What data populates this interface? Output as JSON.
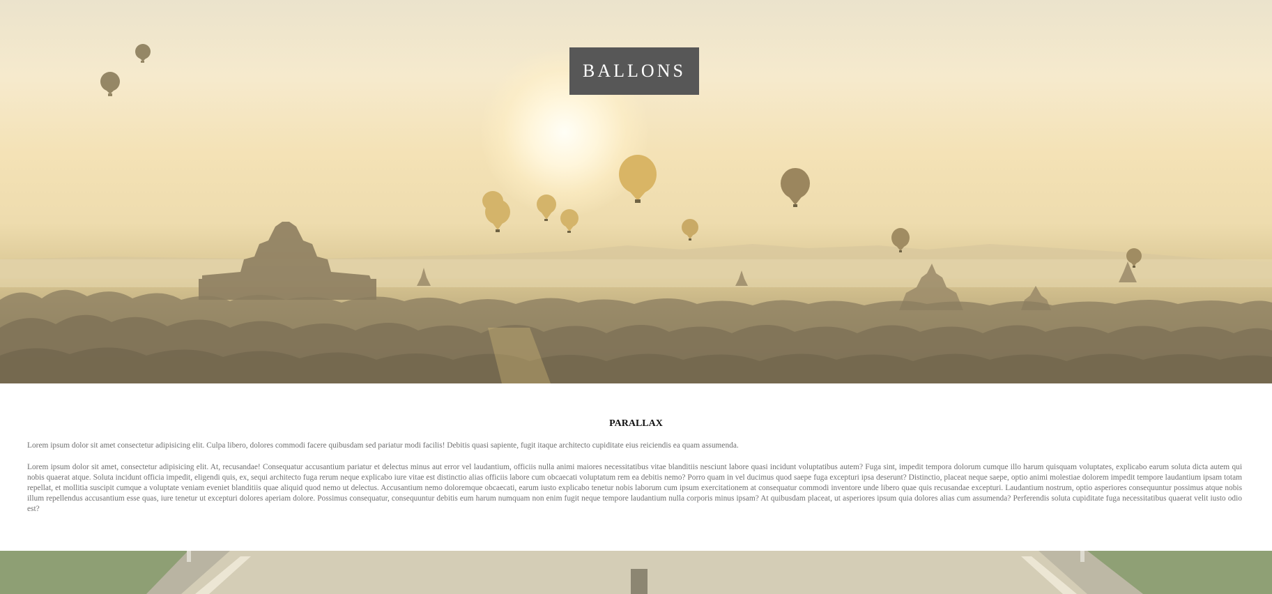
{
  "hero": {
    "title": "BALLONS"
  },
  "section": {
    "title": "PARALLAX",
    "paragraph1": "Lorem ipsum dolor sit amet consectetur adipisicing elit. Culpa libero, dolores commodi facere quibusdam sed pariatur modi facilis! Debitis quasi sapiente, fugit itaque architecto cupiditate eius reiciendis ea quam assumenda.",
    "paragraph2": "Lorem ipsum dolor sit amet, consectetur adipisicing elit. At, recusandae! Consequatur accusantium pariatur et delectus minus aut error vel laudantium, officiis nulla animi maiores necessitatibus vitae blanditiis nesciunt labore quasi incidunt voluptatibus autem? Fuga sint, impedit tempora dolorum cumque illo harum quisquam voluptates, explicabo earum soluta dicta autem qui nobis quaerat atque. Soluta incidunt officia impedit, eligendi quis, ex, sequi architecto fuga rerum neque explicabo iure vitae est distinctio alias officiis labore cum obcaecati voluptatum rem ea debitis nemo? Porro quam in vel ducimus quod saepe fuga excepturi ipsa deserunt? Distinctio, placeat neque saepe, optio animi molestiae dolorem impedit tempore laudantium ipsam totam repellat, et mollitia suscipit cumque a voluptate veniam eveniet blanditiis quae aliquid quod nemo ut delectus. Accusantium nemo doloremque obcaecati, earum iusto explicabo tenetur nobis laborum cum ipsum exercitationem at consequatur commodi inventore unde libero quae quis recusandae excepturi. Laudantium nostrum, optio asperiores consequuntur possimus atque nobis illum repellendus accusantium esse quas, iure tenetur ut excepturi dolores aperiam dolore. Possimus consequatur, consequuntur debitis eum harum numquam non enim fugit neque tempore laudantium nulla corporis minus ipsam? At quibusdam placeat, ut asperiores ipsum quia dolores alias cum assumenda? Perferendis soluta cupiditate fuga necessitatibus quaerat velit iusto odio est?"
  },
  "images": {
    "hero_background": "hot-air-balloons-over-temples-at-sunrise",
    "road_background": "road-with-grass-edges"
  },
  "colors": {
    "title_box": "#575757",
    "title_text": "#ffffff",
    "body_text": "#6f6f6f",
    "heading_text": "#111111"
  }
}
